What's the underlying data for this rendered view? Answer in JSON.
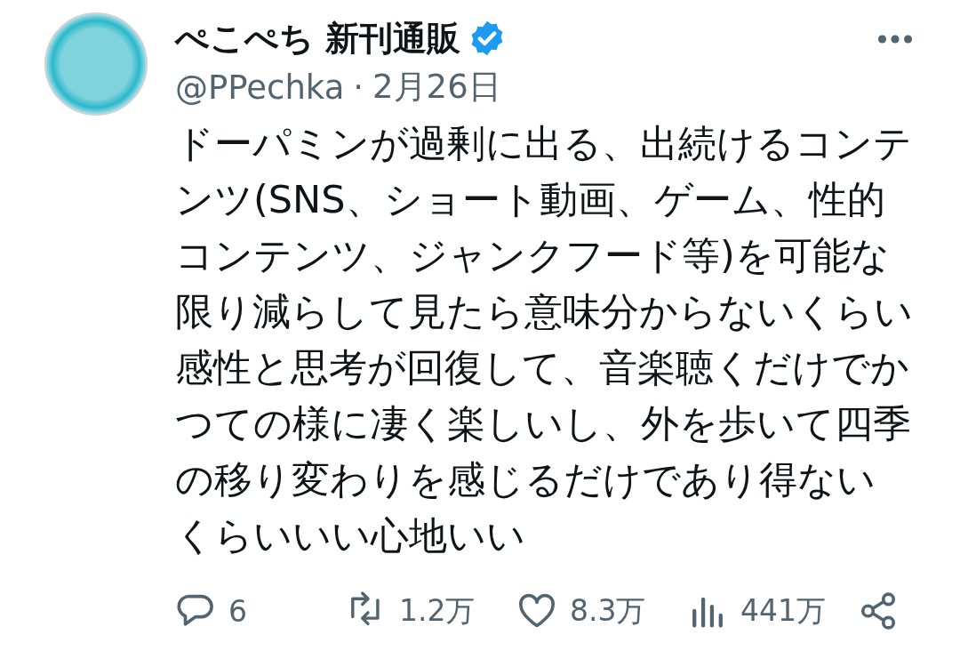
{
  "author": {
    "name": "ぺこぺち 新刊通販",
    "verified": true,
    "handle": "@PPechka",
    "separator": "·",
    "date": "2月26日"
  },
  "body": "ドーパミンが過剰に出る、出続けるコンテンツ(SNS、ショート動画、ゲーム、性的コンテンツ、ジャンクフード等)を可能な限り減らして見たら意味分からないくらい感性と思考が回復して、音楽聴くだけでかつての様に凄く楽しいし、外を歩いて四季の移り変わりを感じるだけであり得ないくらいいい心地いい",
  "actions": [
    {
      "kind": "reply",
      "count": "6"
    },
    {
      "kind": "repost",
      "count": "1.2万"
    },
    {
      "kind": "like",
      "count": "8.3万"
    },
    {
      "kind": "views",
      "count": "441万"
    },
    {
      "kind": "share"
    }
  ]
}
